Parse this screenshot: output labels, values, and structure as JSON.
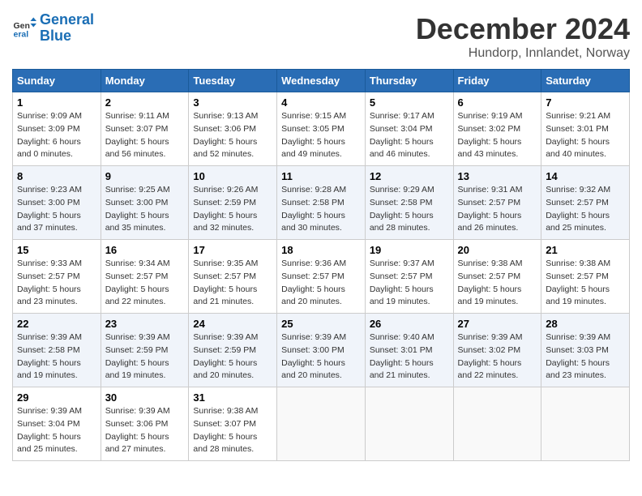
{
  "logo": {
    "text_general": "General",
    "text_blue": "Blue"
  },
  "header": {
    "month": "December 2024",
    "location": "Hundorp, Innlandet, Norway"
  },
  "weekdays": [
    "Sunday",
    "Monday",
    "Tuesday",
    "Wednesday",
    "Thursday",
    "Friday",
    "Saturday"
  ],
  "weeks": [
    [
      {
        "day": "1",
        "sunrise": "9:09 AM",
        "sunset": "3:09 PM",
        "daylight": "6 hours and 0 minutes."
      },
      {
        "day": "2",
        "sunrise": "9:11 AM",
        "sunset": "3:07 PM",
        "daylight": "5 hours and 56 minutes."
      },
      {
        "day": "3",
        "sunrise": "9:13 AM",
        "sunset": "3:06 PM",
        "daylight": "5 hours and 52 minutes."
      },
      {
        "day": "4",
        "sunrise": "9:15 AM",
        "sunset": "3:05 PM",
        "daylight": "5 hours and 49 minutes."
      },
      {
        "day": "5",
        "sunrise": "9:17 AM",
        "sunset": "3:04 PM",
        "daylight": "5 hours and 46 minutes."
      },
      {
        "day": "6",
        "sunrise": "9:19 AM",
        "sunset": "3:02 PM",
        "daylight": "5 hours and 43 minutes."
      },
      {
        "day": "7",
        "sunrise": "9:21 AM",
        "sunset": "3:01 PM",
        "daylight": "5 hours and 40 minutes."
      }
    ],
    [
      {
        "day": "8",
        "sunrise": "9:23 AM",
        "sunset": "3:00 PM",
        "daylight": "5 hours and 37 minutes."
      },
      {
        "day": "9",
        "sunrise": "9:25 AM",
        "sunset": "3:00 PM",
        "daylight": "5 hours and 35 minutes."
      },
      {
        "day": "10",
        "sunrise": "9:26 AM",
        "sunset": "2:59 PM",
        "daylight": "5 hours and 32 minutes."
      },
      {
        "day": "11",
        "sunrise": "9:28 AM",
        "sunset": "2:58 PM",
        "daylight": "5 hours and 30 minutes."
      },
      {
        "day": "12",
        "sunrise": "9:29 AM",
        "sunset": "2:58 PM",
        "daylight": "5 hours and 28 minutes."
      },
      {
        "day": "13",
        "sunrise": "9:31 AM",
        "sunset": "2:57 PM",
        "daylight": "5 hours and 26 minutes."
      },
      {
        "day": "14",
        "sunrise": "9:32 AM",
        "sunset": "2:57 PM",
        "daylight": "5 hours and 25 minutes."
      }
    ],
    [
      {
        "day": "15",
        "sunrise": "9:33 AM",
        "sunset": "2:57 PM",
        "daylight": "5 hours and 23 minutes."
      },
      {
        "day": "16",
        "sunrise": "9:34 AM",
        "sunset": "2:57 PM",
        "daylight": "5 hours and 22 minutes."
      },
      {
        "day": "17",
        "sunrise": "9:35 AM",
        "sunset": "2:57 PM",
        "daylight": "5 hours and 21 minutes."
      },
      {
        "day": "18",
        "sunrise": "9:36 AM",
        "sunset": "2:57 PM",
        "daylight": "5 hours and 20 minutes."
      },
      {
        "day": "19",
        "sunrise": "9:37 AM",
        "sunset": "2:57 PM",
        "daylight": "5 hours and 19 minutes."
      },
      {
        "day": "20",
        "sunrise": "9:38 AM",
        "sunset": "2:57 PM",
        "daylight": "5 hours and 19 minutes."
      },
      {
        "day": "21",
        "sunrise": "9:38 AM",
        "sunset": "2:57 PM",
        "daylight": "5 hours and 19 minutes."
      }
    ],
    [
      {
        "day": "22",
        "sunrise": "9:39 AM",
        "sunset": "2:58 PM",
        "daylight": "5 hours and 19 minutes."
      },
      {
        "day": "23",
        "sunrise": "9:39 AM",
        "sunset": "2:59 PM",
        "daylight": "5 hours and 19 minutes."
      },
      {
        "day": "24",
        "sunrise": "9:39 AM",
        "sunset": "2:59 PM",
        "daylight": "5 hours and 20 minutes."
      },
      {
        "day": "25",
        "sunrise": "9:39 AM",
        "sunset": "3:00 PM",
        "daylight": "5 hours and 20 minutes."
      },
      {
        "day": "26",
        "sunrise": "9:40 AM",
        "sunset": "3:01 PM",
        "daylight": "5 hours and 21 minutes."
      },
      {
        "day": "27",
        "sunrise": "9:39 AM",
        "sunset": "3:02 PM",
        "daylight": "5 hours and 22 minutes."
      },
      {
        "day": "28",
        "sunrise": "9:39 AM",
        "sunset": "3:03 PM",
        "daylight": "5 hours and 23 minutes."
      }
    ],
    [
      {
        "day": "29",
        "sunrise": "9:39 AM",
        "sunset": "3:04 PM",
        "daylight": "5 hours and 25 minutes."
      },
      {
        "day": "30",
        "sunrise": "9:39 AM",
        "sunset": "3:06 PM",
        "daylight": "5 hours and 27 minutes."
      },
      {
        "day": "31",
        "sunrise": "9:38 AM",
        "sunset": "3:07 PM",
        "daylight": "5 hours and 28 minutes."
      },
      null,
      null,
      null,
      null
    ]
  ],
  "labels": {
    "sunrise": "Sunrise:",
    "sunset": "Sunset:",
    "daylight": "Daylight:"
  }
}
